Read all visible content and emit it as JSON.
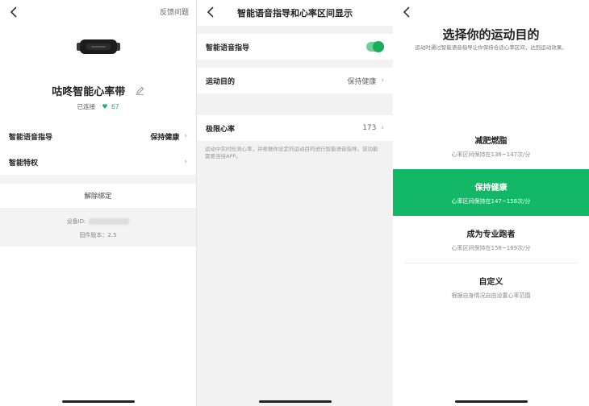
{
  "screen1": {
    "feedback_label": "反馈问题",
    "device_name": "咕咚智能心率带",
    "status": "已连接",
    "heart_rate": "67",
    "rows": [
      {
        "label": "智能语音指导",
        "value": "保持健康"
      },
      {
        "label": "智能特权",
        "value": ""
      }
    ],
    "unbind_label": "解除绑定",
    "device_id_label": "设备ID:",
    "firmware_label": "固件版本：2.5"
  },
  "screen2": {
    "title": "智能语音指导和心率区间显示",
    "voice_label": "智能语音指导",
    "voice_enabled": true,
    "goal_label": "运动目的",
    "goal_value": "保持健康",
    "max_hr_label": "极限心率",
    "max_hr_value": "173",
    "note": "运动中实时检测心率，并根据你设定的运动目的进行智能语音指导。该功能需要连接APP。"
  },
  "screen3": {
    "title": "选择你的运动目的",
    "subtitle": "运动时通过智能语音指导让你保持合适心率区间，达到运动效果。",
    "goals": [
      {
        "name": "减肥燃脂",
        "desc": "心率区间保持在136~147次/分",
        "selected": false
      },
      {
        "name": "保持健康",
        "desc": "心率区间保持在147~158次/分",
        "selected": true
      },
      {
        "name": "成为专业跑者",
        "desc": "心率区间保持在158~169次/分",
        "selected": false
      },
      {
        "name": "自定义",
        "desc": "根据自身情况自由设置心率范围",
        "selected": false
      }
    ]
  },
  "colors": {
    "accent": "#12b866",
    "toggle_on": "#1aad5b",
    "heart": "#1ab566"
  },
  "icons": {
    "back": "chevron-left-icon",
    "edit": "pencil-icon",
    "heart": "heart-icon",
    "row_arrow": "chevron-right-icon",
    "device": "heart-rate-strap-image"
  }
}
